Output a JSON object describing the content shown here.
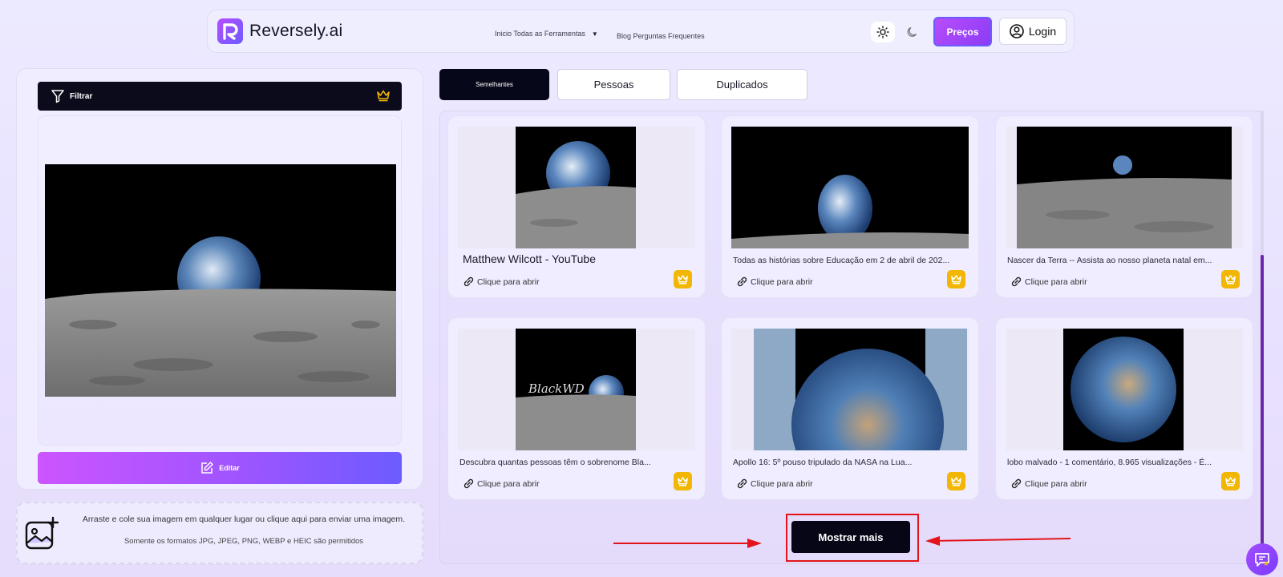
{
  "header": {
    "logo_text": "Reversely.ai",
    "nav_inicio_tools": "Inicio Todas as Ferramentas",
    "nav_blog_faq": "Blog Perguntas Frequentes",
    "precos_label": "Preços",
    "login_label": "Login"
  },
  "left_panel": {
    "filter_label": "Filtrar",
    "edit_label": "Editar",
    "upload_text": "Arraste e cole sua imagem em qualquer lugar ou clique aqui para enviar uma imagem.",
    "formats_text": "Somente os formatos JPG, JPEG, PNG, WEBP e HEIC são permitidos"
  },
  "tabs": [
    {
      "label": "Semelhantes",
      "active": true
    },
    {
      "label": "Pessoas",
      "active": false
    },
    {
      "label": "Duplicados",
      "active": false
    }
  ],
  "results": [
    {
      "title": "Matthew Wilcott - YouTube",
      "link_label": "Clique para abrir"
    },
    {
      "title": "Todas as histórias sobre Educação em 2 de abril de 202...",
      "link_label": "Clique para abrir"
    },
    {
      "title": "Nascer da Terra -- Assista ao nosso planeta natal em...",
      "link_label": "Clique para abrir"
    },
    {
      "title": "Descubra quantas pessoas têm o sobrenome Bla...",
      "link_label": "Clique para abrir",
      "image_watermark": "BlackWD"
    },
    {
      "title": "Apollo 16: 5º pouso tripulado da NASA na Lua...",
      "link_label": "Clique para abrir"
    },
    {
      "title": "lobo malvado - 1 comentário, 8.965 visualizações - É...",
      "link_label": "Clique para abrir"
    }
  ],
  "show_more_label": "Mostrar mais",
  "colors": {
    "brand_purple": "#8b3cf4",
    "crown_badge": "#f2b705",
    "annotation_red": "#e4141a",
    "dark": "#07071a"
  }
}
